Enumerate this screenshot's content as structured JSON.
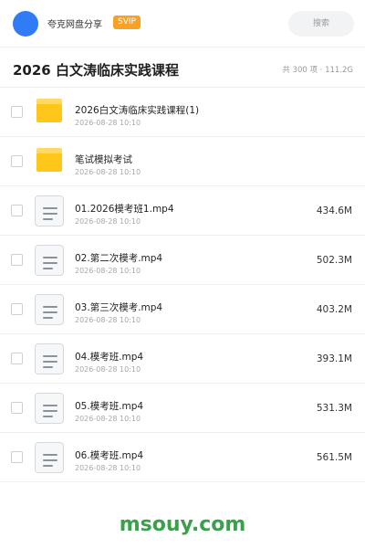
{
  "header": {
    "share_name": "夸克网盘分享",
    "badge": "SVIP",
    "search_placeholder": "搜索"
  },
  "folder": {
    "title": "2026 白文涛临床实践课程",
    "summary": "共 300 项 · 111.2G"
  },
  "files": [
    {
      "type": "folder",
      "name": "2026白文涛临床实践课程(1)",
      "date": "2026-08-28 10:10",
      "size": ""
    },
    {
      "type": "folder",
      "name": "笔试模拟考试",
      "date": "2026-08-28 10:10",
      "size": ""
    },
    {
      "type": "file",
      "name": "01.2026模考班1.mp4",
      "date": "2026-08-28 10:10",
      "size": "434.6M"
    },
    {
      "type": "file",
      "name": "02.第二次模考.mp4",
      "date": "2026-08-28 10:10",
      "size": "502.3M"
    },
    {
      "type": "file",
      "name": "03.第三次模考.mp4",
      "date": "2026-08-28 10:10",
      "size": "403.2M"
    },
    {
      "type": "file",
      "name": "04.模考班.mp4",
      "date": "2026-08-28 10:10",
      "size": "393.1M"
    },
    {
      "type": "file",
      "name": "05.模考班.mp4",
      "date": "2026-08-28 10:10",
      "size": "531.3M"
    },
    {
      "type": "file",
      "name": "06.模考班.mp4",
      "date": "2026-08-28 10:10",
      "size": "561.5M"
    }
  ],
  "watermark": "msouy.com",
  "colors": {
    "avatar": "#2f7cf6",
    "badge": "#f7a126",
    "folder": "#ffc61a",
    "watermark": "#3aa14a"
  }
}
